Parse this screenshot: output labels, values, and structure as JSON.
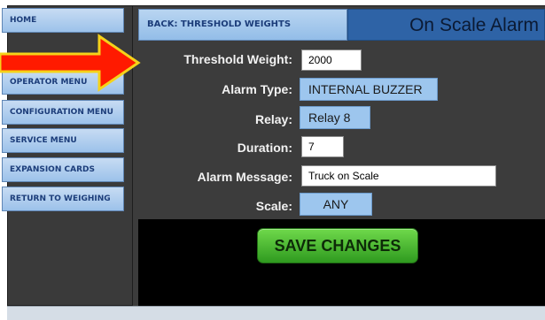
{
  "sidebar": {
    "items": [
      {
        "label": "HOME"
      },
      {
        "label": "OPERATOR MENU"
      },
      {
        "label": "CONFIGURATION MENU"
      },
      {
        "label": "SERVICE MENU"
      },
      {
        "label": "EXPANSION CARDS"
      },
      {
        "label": "RETURN TO WEIGHING"
      }
    ]
  },
  "header": {
    "back_label": "BACK: THRESHOLD WEIGHTS",
    "title": "On Scale Alarm"
  },
  "form": {
    "threshold_weight": {
      "label": "Threshold Weight:",
      "value": "2000"
    },
    "alarm_type": {
      "label": "Alarm Type:",
      "value": "INTERNAL BUZZER"
    },
    "relay": {
      "label": "Relay:",
      "value": "Relay 8"
    },
    "duration": {
      "label": "Duration:",
      "value": "7"
    },
    "alarm_message": {
      "label": "Alarm Message:",
      "value": "Truck on Scale"
    },
    "scale": {
      "label": "Scale:",
      "value": "ANY"
    }
  },
  "actions": {
    "save_label": "SAVE CHANGES"
  },
  "annotation": {
    "arrow_color": "#ff1a00",
    "arrow_outline": "#f5d21a"
  }
}
